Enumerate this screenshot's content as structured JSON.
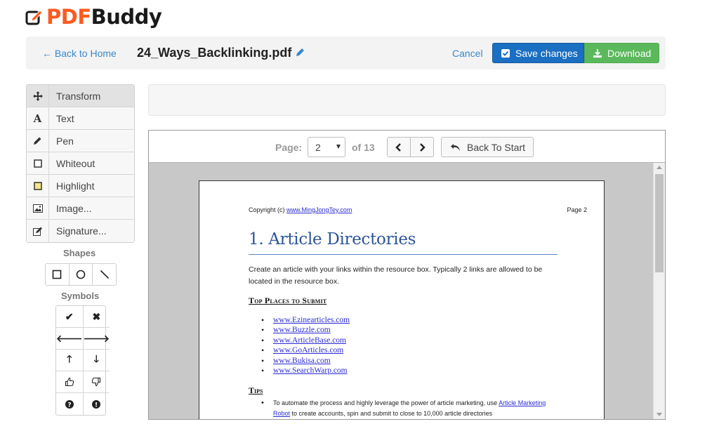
{
  "brand": {
    "pdf": "PDF",
    "buddy": "Buddy",
    "accent": "#ff5a1f"
  },
  "topbar": {
    "back_label": "← Back to Home",
    "filename": "24_Ways_Backlinking.pdf",
    "cancel_label": "Cancel",
    "save_label": "Save changes",
    "download_label": "Download"
  },
  "tools": [
    {
      "label": "Transform",
      "icon": "move-icon",
      "active": true
    },
    {
      "label": "Text",
      "icon": "text-icon"
    },
    {
      "label": "Pen",
      "icon": "pen-icon"
    },
    {
      "label": "Whiteout",
      "icon": "whiteout-icon"
    },
    {
      "label": "Highlight",
      "icon": "highlight-icon"
    },
    {
      "label": "Image...",
      "icon": "image-icon"
    },
    {
      "label": "Signature...",
      "icon": "signature-icon"
    }
  ],
  "shapes": {
    "title": "Shapes",
    "items": [
      "rectangle-icon",
      "circle-icon",
      "line-icon"
    ]
  },
  "symbols": {
    "title": "Symbols",
    "items": [
      "check-icon",
      "x-icon",
      "arrow-left-icon",
      "arrow-right-icon",
      "arrow-up-icon",
      "arrow-down-icon",
      "thumbs-up-icon",
      "thumbs-down-icon",
      "question-icon",
      "exclamation-icon"
    ]
  },
  "viewer": {
    "page_label": "Page:",
    "page_value": "2",
    "of_total": "of 13",
    "back_to_start": "Back To Start"
  },
  "document": {
    "copyright_prefix": "Copyright (c) ",
    "copyright_link": "www.MingJongTey.com",
    "page_number": "Page 2",
    "title": "1. Article Directories",
    "intro": "Create an article with your links within the resource box. Typically 2 links are allowed to be located in the resource box.",
    "subhead": "Top Places to Submit",
    "sites": [
      "www.Ezinearticles.com",
      "www.Buzzle.com",
      "www.ArticleBase.com",
      "www.GoArticles.com",
      "www.Bukisa.com",
      "www.SearchWarp.com"
    ],
    "tips_head": "Tips",
    "tip_text_1": "To automate the process and highly leverage the power of article marketing, use ",
    "tip_link": "Article Marketing Robot",
    "tip_text_2": " to create accounts, spin and submit to close to 10,000 article directories"
  }
}
